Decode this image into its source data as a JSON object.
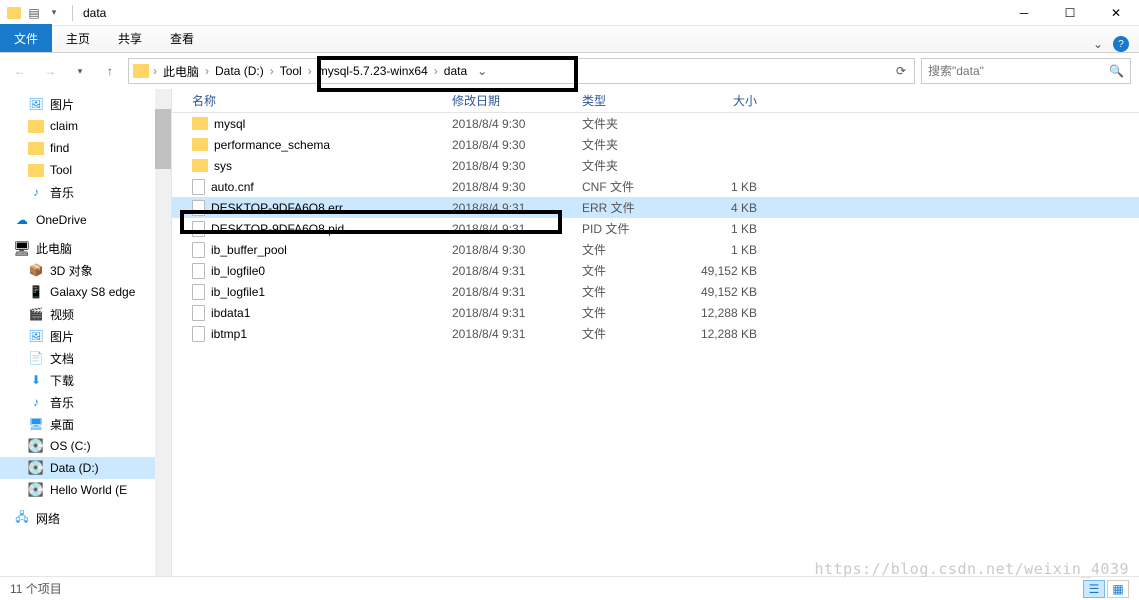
{
  "titlebar": {
    "title": "data"
  },
  "ribbon": {
    "file": "文件",
    "tabs": [
      "主页",
      "共享",
      "查看"
    ]
  },
  "nav": {
    "breadcrumb": [
      "此电脑",
      "Data (D:)",
      "Tool",
      "mysql-5.7.23-winx64",
      "data"
    ],
    "search_placeholder": "搜索\"data\""
  },
  "sidebar": {
    "quick": [
      {
        "label": "图片",
        "icon": "pic"
      },
      {
        "label": "claim",
        "icon": "folder"
      },
      {
        "label": "find",
        "icon": "folder"
      },
      {
        "label": "Tool",
        "icon": "folder"
      },
      {
        "label": "音乐",
        "icon": "music"
      }
    ],
    "onedrive": "OneDrive",
    "thispc": "此电脑",
    "pc_items": [
      {
        "label": "3D 对象",
        "icon": "3d"
      },
      {
        "label": "Galaxy S8 edge",
        "icon": "phone"
      },
      {
        "label": "视频",
        "icon": "video"
      },
      {
        "label": "图片",
        "icon": "pic"
      },
      {
        "label": "文档",
        "icon": "doc"
      },
      {
        "label": "下载",
        "icon": "dl"
      },
      {
        "label": "音乐",
        "icon": "music"
      },
      {
        "label": "桌面",
        "icon": "desk"
      },
      {
        "label": "OS (C:)",
        "icon": "drive"
      },
      {
        "label": "Data (D:)",
        "icon": "drive",
        "active": true
      },
      {
        "label": "Hello World (E",
        "icon": "drive"
      }
    ],
    "network": "网络"
  },
  "columns": {
    "name": "名称",
    "date": "修改日期",
    "type": "类型",
    "size": "大小"
  },
  "files": [
    {
      "name": "mysql",
      "date": "2018/8/4 9:30",
      "type": "文件夹",
      "size": "",
      "icon": "folder"
    },
    {
      "name": "performance_schema",
      "date": "2018/8/4 9:30",
      "type": "文件夹",
      "size": "",
      "icon": "folder"
    },
    {
      "name": "sys",
      "date": "2018/8/4 9:30",
      "type": "文件夹",
      "size": "",
      "icon": "folder"
    },
    {
      "name": "auto.cnf",
      "date": "2018/8/4 9:30",
      "type": "CNF 文件",
      "size": "1 KB",
      "icon": "file"
    },
    {
      "name": "DESKTOP-9DFA6O8.err",
      "date": "2018/8/4 9:31",
      "type": "ERR 文件",
      "size": "4 KB",
      "icon": "file",
      "selected": true
    },
    {
      "name": "DESKTOP-9DFA6O8.pid",
      "date": "2018/8/4 9:31",
      "type": "PID 文件",
      "size": "1 KB",
      "icon": "file"
    },
    {
      "name": "ib_buffer_pool",
      "date": "2018/8/4 9:30",
      "type": "文件",
      "size": "1 KB",
      "icon": "file"
    },
    {
      "name": "ib_logfile0",
      "date": "2018/8/4 9:31",
      "type": "文件",
      "size": "49,152 KB",
      "icon": "file"
    },
    {
      "name": "ib_logfile1",
      "date": "2018/8/4 9:31",
      "type": "文件",
      "size": "49,152 KB",
      "icon": "file"
    },
    {
      "name": "ibdata1",
      "date": "2018/8/4 9:31",
      "type": "文件",
      "size": "12,288 KB",
      "icon": "file"
    },
    {
      "name": "ibtmp1",
      "date": "2018/8/4 9:31",
      "type": "文件",
      "size": "12,288 KB",
      "icon": "file"
    }
  ],
  "status": {
    "count": "11 个项目"
  },
  "watermark": "https://blog.csdn.net/weixin_4039"
}
